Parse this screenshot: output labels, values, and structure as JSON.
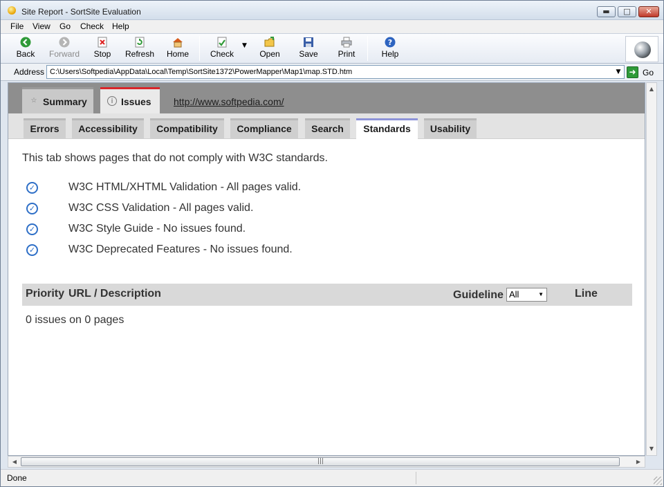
{
  "window": {
    "title": "Site Report - SortSite Evaluation"
  },
  "menu": [
    "File",
    "View",
    "Go",
    "Check",
    "Help"
  ],
  "toolbar": {
    "back": "Back",
    "forward": "Forward",
    "stop": "Stop",
    "refresh": "Refresh",
    "home": "Home",
    "check": "Check",
    "open": "Open",
    "save": "Save",
    "print": "Print",
    "help": "Help"
  },
  "address": {
    "label": "Address",
    "value": "C:\\Users\\Softpedia\\AppData\\Local\\Temp\\SortSite1372\\PowerMapper\\Map1\\map.STD.htm",
    "go": "Go"
  },
  "report": {
    "main_tabs": [
      "Summary",
      "Issues"
    ],
    "active_main_tab": "Issues",
    "site_url": "http://www.softpedia.com/",
    "sub_tabs": [
      "Errors",
      "Accessibility",
      "Compatibility",
      "Compliance",
      "Search",
      "Standards",
      "Usability"
    ],
    "active_sub_tab": "Standards",
    "description": "This tab shows pages that do not comply with W3C standards.",
    "checks": [
      "W3C HTML/XHTML Validation - All pages valid.",
      "W3C CSS Validation - All pages valid.",
      "W3C Style Guide - No issues found.",
      "W3C Deprecated Features - No issues found."
    ],
    "table": {
      "priority": "Priority",
      "url_desc": "URL / Description",
      "guideline": "Guideline",
      "guideline_value": "All",
      "line": "Line"
    },
    "summary_count": "0 issues on 0 pages"
  },
  "status": {
    "text": "Done"
  },
  "colors": {
    "active_main_tab_accent": "#d9262b",
    "active_sub_tab_accent": "#8d93d8",
    "check_icon": "#2e6fc7"
  }
}
